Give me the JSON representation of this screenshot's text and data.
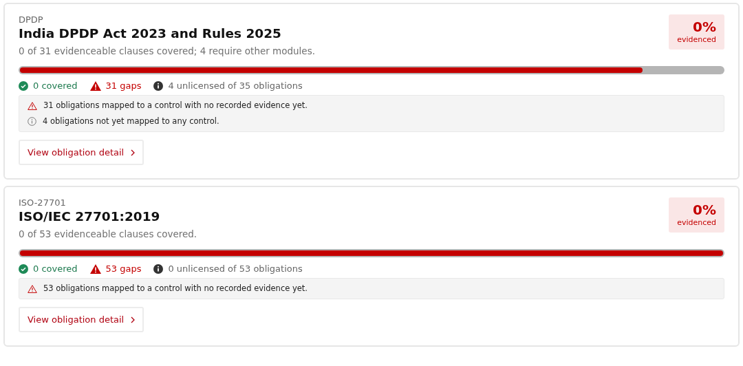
{
  "frameworks": [
    {
      "code": "DPDP",
      "title": "India DPDP Act 2023 and Rules 2025",
      "summary": "0 of 31 evidenceable clauses covered; 4 require other modules.",
      "score": {
        "value": "0%",
        "label": "evidenced"
      },
      "gap_bar": {
        "level": 0.886
      },
      "stats": [
        {
          "kind": "covered",
          "text": "0 covered"
        },
        {
          "kind": "gaps",
          "text": "31 gaps"
        },
        {
          "kind": "unlicensed",
          "text": "4 unlicensed of 35 obligations"
        }
      ],
      "notes": [
        {
          "kind": "warning",
          "text": "31 obligations mapped to a control with no recorded evidence yet."
        },
        {
          "kind": "info",
          "text": "4 obligations not yet mapped to any control."
        }
      ],
      "button": "View obligation detail"
    },
    {
      "code": "ISO-27701",
      "title": "ISO/IEC 27701:2019",
      "summary": "0 of 53 evidenceable clauses covered.",
      "score": {
        "value": "0%",
        "label": "evidenced"
      },
      "gap_bar": {
        "level": 1
      },
      "stats": [
        {
          "kind": "covered",
          "text": "0 covered"
        },
        {
          "kind": "gaps",
          "text": "53 gaps"
        },
        {
          "kind": "unlicensed",
          "text": "0 unlicensed of 53 obligations"
        }
      ],
      "notes": [
        {
          "kind": "warning",
          "text": "53 obligations mapped to a control with no recorded evidence yet."
        }
      ],
      "button": "View obligation detail"
    }
  ]
}
